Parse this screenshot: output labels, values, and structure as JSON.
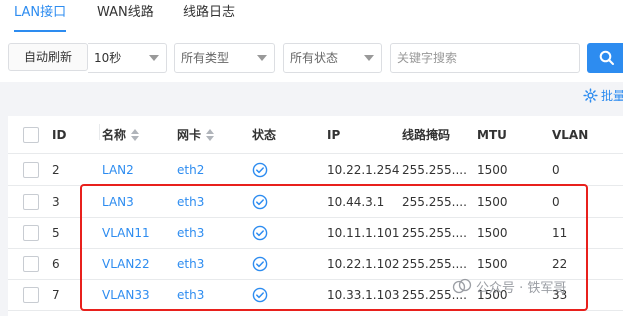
{
  "tabs": [
    {
      "label": "LAN接口",
      "active": true
    },
    {
      "label": "WAN线路",
      "active": false
    },
    {
      "label": "线路日志",
      "active": false
    }
  ],
  "toolbar": {
    "refresh_button": "自动刷新",
    "interval_value": "10秒",
    "type_value": "所有类型",
    "status_value": "所有状态",
    "search_placeholder": "关键字搜索"
  },
  "batch_label": "批量",
  "table": {
    "columns": [
      "ID",
      "名称",
      "网卡",
      "状态",
      "IP",
      "线路掩码",
      "MTU",
      "VLAN"
    ],
    "rows": [
      {
        "id": "2",
        "name": "LAN2",
        "nic": "eth2",
        "ip": "10.22.1.254",
        "mask": "255.255....",
        "mtu": "1500",
        "vlan": "0"
      },
      {
        "id": "3",
        "name": "LAN3",
        "nic": "eth3",
        "ip": "10.44.3.1",
        "mask": "255.255....",
        "mtu": "1500",
        "vlan": "0"
      },
      {
        "id": "5",
        "name": "VLAN11",
        "nic": "eth3",
        "ip": "10.11.1.101",
        "mask": "255.255....",
        "mtu": "1500",
        "vlan": "11"
      },
      {
        "id": "6",
        "name": "VLAN22",
        "nic": "eth3",
        "ip": "10.22.1.102",
        "mask": "255.255....",
        "mtu": "1500",
        "vlan": "22"
      },
      {
        "id": "7",
        "name": "VLAN33",
        "nic": "eth3",
        "ip": "10.33.1.103",
        "mask": "255.255....",
        "mtu": "1500",
        "vlan": "33"
      }
    ]
  },
  "watermark": "公众号 · 铁军哥",
  "colors": {
    "accent": "#2d8cf0",
    "highlight": "#e8201c"
  }
}
